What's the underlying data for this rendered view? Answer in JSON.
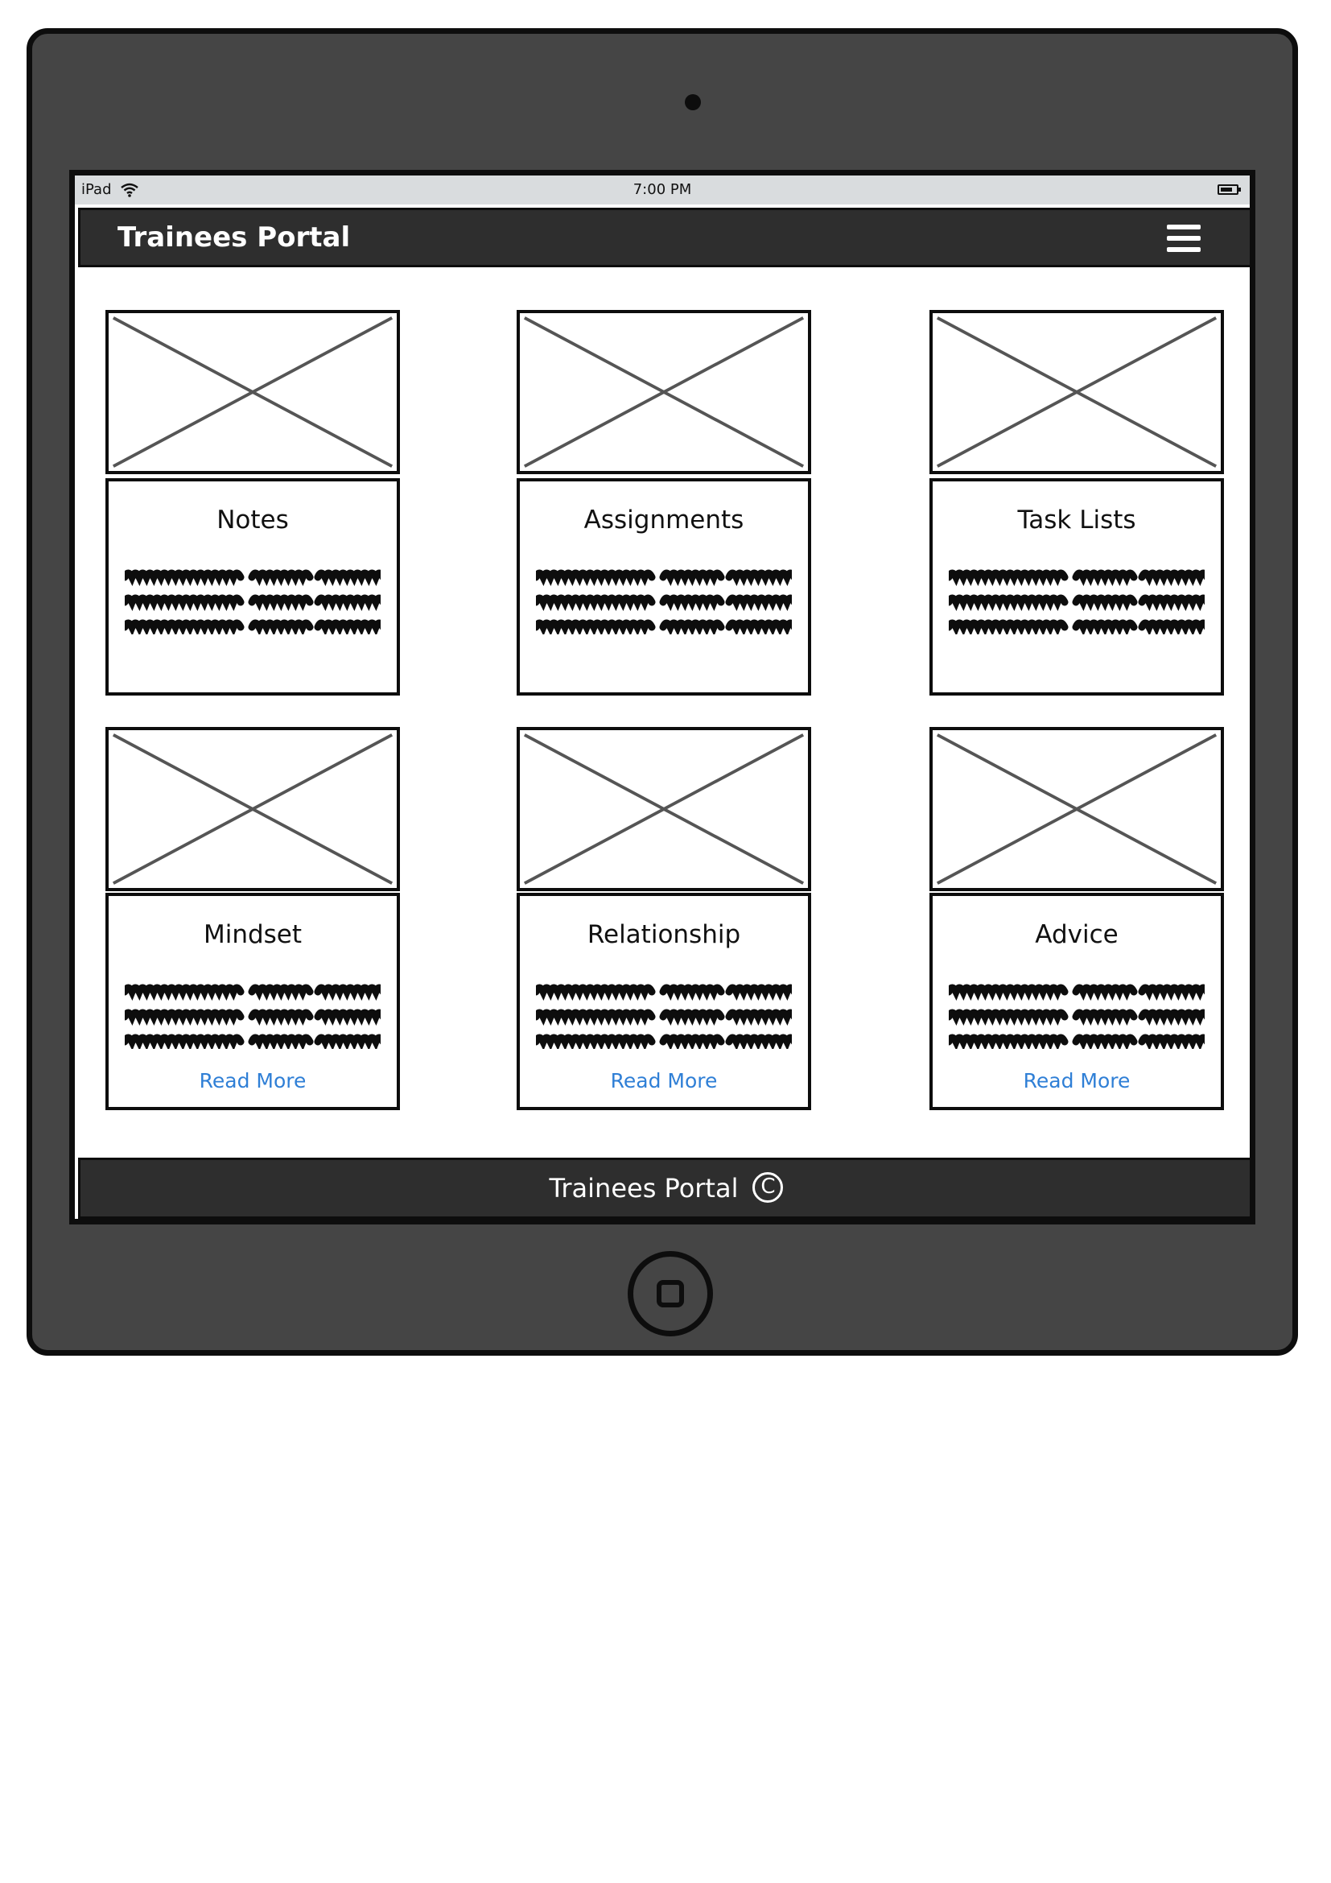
{
  "status_bar": {
    "device": "iPad",
    "time": "7:00 PM",
    "wifi_icon": "wifi-icon",
    "battery_icon": "battery-icon"
  },
  "header": {
    "title": "Trainees Portal",
    "menu_icon": "hamburger-icon"
  },
  "cards": [
    {
      "title": "Notes",
      "image_icon": "image-placeholder-icon",
      "read_more": ""
    },
    {
      "title": "Assignments",
      "image_icon": "image-placeholder-icon",
      "read_more": ""
    },
    {
      "title": "Task Lists",
      "image_icon": "image-placeholder-icon",
      "read_more": ""
    },
    {
      "title": "Mindset",
      "image_icon": "image-placeholder-icon",
      "read_more": "Read More"
    },
    {
      "title": "Relationship",
      "image_icon": "image-placeholder-icon",
      "read_more": "Read More"
    },
    {
      "title": "Advice",
      "image_icon": "image-placeholder-icon",
      "read_more": "Read More"
    }
  ],
  "footer": {
    "text": "Trainees Portal",
    "copyright_icon": "copyright-icon"
  },
  "colors": {
    "frame": "#454545",
    "bar": "#2e2e2e",
    "link": "#2f7fd6",
    "status_bar": "#d9dcde"
  }
}
